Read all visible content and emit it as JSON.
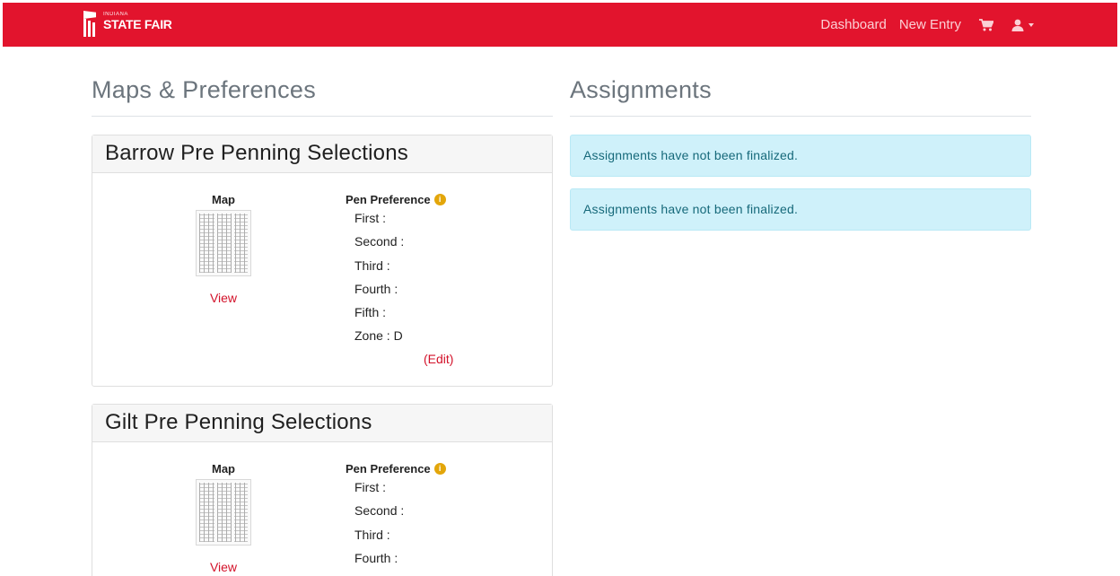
{
  "brand": {
    "small_text": "INDIANA",
    "name": "STATE FAIR"
  },
  "nav": {
    "dashboard": "Dashboard",
    "new_entry": "New Entry",
    "cart_icon": "cart-icon",
    "user_icon": "user-icon"
  },
  "left": {
    "title": "Maps & Preferences",
    "cards": [
      {
        "title": "Barrow Pre Penning Selections",
        "map_label": "Map",
        "view_label": "View",
        "pref_label": "Pen Preference",
        "prefs": [
          "First :",
          "Second :",
          "Third :",
          "Fourth :",
          "Fifth :",
          "Zone : D"
        ],
        "edit_label": "(Edit)"
      },
      {
        "title": "Gilt Pre Penning Selections",
        "map_label": "Map",
        "view_label": "View",
        "pref_label": "Pen Preference",
        "prefs": [
          "First :",
          "Second :",
          "Third :",
          "Fourth :"
        ]
      }
    ]
  },
  "right": {
    "title": "Assignments",
    "alerts": [
      "Assignments have not been finalized.",
      "Assignments have not been finalized."
    ]
  },
  "colors": {
    "brand_red": "#e2142d",
    "link_red": "#d3122a",
    "info_bg": "#cff1fa",
    "info_text": "#16697a",
    "info_icon": "#e3a60a"
  }
}
